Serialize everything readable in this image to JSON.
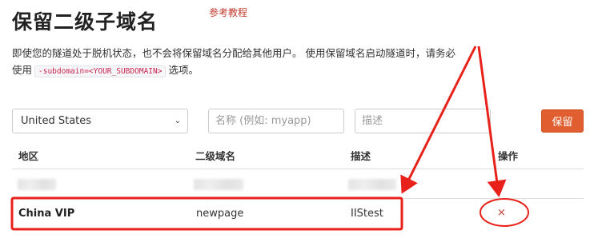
{
  "page": {
    "title": "保留二级子域名",
    "tutorial_link": "参考教程",
    "description_part1": "即使您的隧道处于脱机状态，也不会将保留域名分配给其他用户。 使用保留域名启动隧道时，请务必使用",
    "description_code": "-subdomain=<YOUR_SUBDOMAIN>",
    "description_part2": "选项。"
  },
  "form": {
    "region_selected": "United States",
    "name_placeholder": "名称 (例如: myapp)",
    "desc_placeholder": "描述",
    "reserve_label": "保留"
  },
  "table": {
    "headers": [
      "地区",
      "二级域名",
      "描述",
      "操作"
    ],
    "rows": [
      {
        "region": "",
        "subdomain": "",
        "description": "",
        "blurred": true
      },
      {
        "region": "China VIP",
        "subdomain": "newpage",
        "description": "IIStest",
        "action": "×"
      }
    ]
  },
  "colors": {
    "accent": "#e05e2f",
    "annotation_red": "#e8221b",
    "link": "#c0392b"
  }
}
